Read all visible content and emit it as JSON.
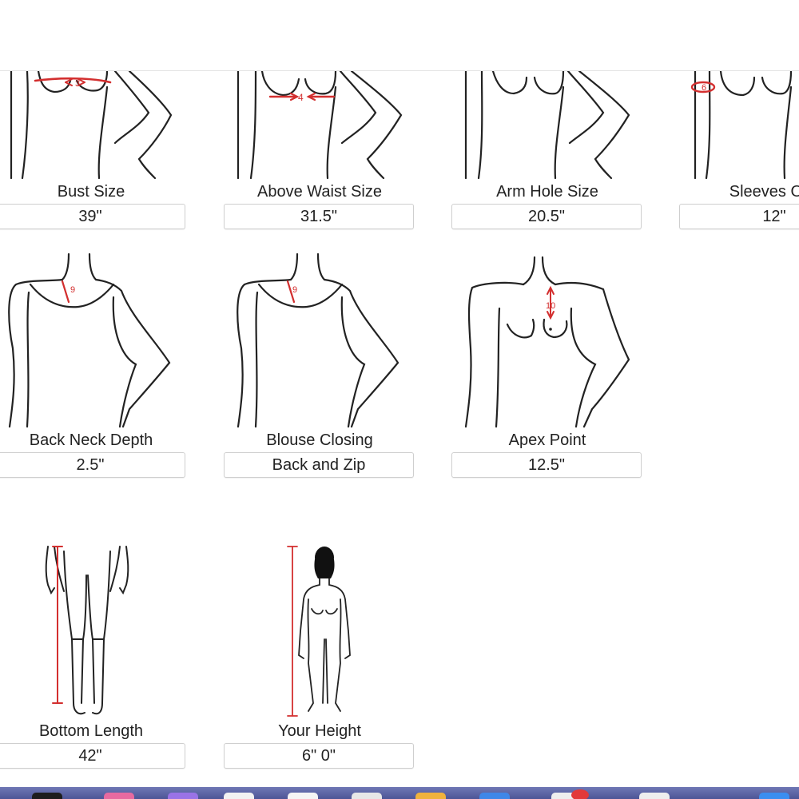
{
  "measurements": {
    "row1": [
      {
        "label": "Bust Size",
        "value": "39\"",
        "marker": "3"
      },
      {
        "label": "Above Waist Size",
        "value": "31.5\"",
        "marker": "4"
      },
      {
        "label": "Arm Hole Size",
        "value": "20.5\""
      },
      {
        "label": "Sleeves Ope",
        "value": "12\"",
        "marker": "6"
      }
    ],
    "row2": [
      {
        "label": "Back Neck Depth",
        "value": "2.5\"",
        "marker": "9"
      },
      {
        "label": "Blouse Closing",
        "value": "Back and Zip",
        "marker": "9"
      },
      {
        "label": "Apex Point",
        "value": "12.5\"",
        "marker": "10"
      }
    ],
    "row3": [
      {
        "label": "Bottom Length",
        "value": "42\""
      },
      {
        "label": "Your Height",
        "value": "6\" 0\""
      }
    ]
  },
  "colors": {
    "accent": "#d32f2f",
    "line": "#222222",
    "dock": "#5a62a6"
  },
  "dock_icons": [
    "finder-icon",
    "app-icon",
    "app-icon",
    "app-icon",
    "app-icon",
    "app-icon",
    "app-icon",
    "app-icon",
    "app-icon",
    "app-icon",
    "app-icon"
  ]
}
